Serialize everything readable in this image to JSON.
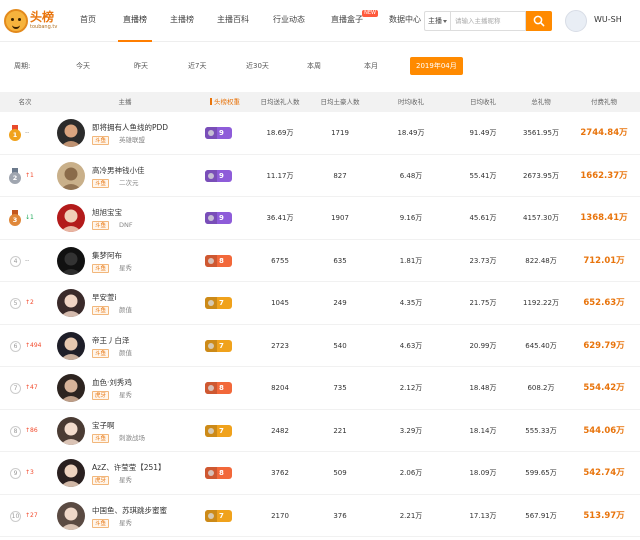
{
  "header": {
    "logo_text": "头榜",
    "logo_sub": "toubang.tv",
    "nav": [
      {
        "label": "首页",
        "active": false,
        "badge": ""
      },
      {
        "label": "直播榜",
        "active": true,
        "badge": ""
      },
      {
        "label": "主播榜",
        "active": false,
        "badge": ""
      },
      {
        "label": "主播百科",
        "active": false,
        "badge": ""
      },
      {
        "label": "行业动态",
        "active": false,
        "badge": ""
      },
      {
        "label": "直播盒子",
        "active": false,
        "badge": "NEW"
      },
      {
        "label": "数据中心",
        "active": false,
        "badge": ""
      }
    ],
    "search": {
      "type_label": "主播",
      "placeholder": "请输入主播昵称",
      "value": ""
    },
    "username": "WU-SH"
  },
  "period": {
    "label": "周期:",
    "options": [
      "今天",
      "昨天",
      "近7天",
      "近30天",
      "本周",
      "本月",
      "2019年04月"
    ],
    "selected": "2019年04月"
  },
  "table": {
    "columns": [
      "名次",
      "主播",
      "头榜权重",
      "日均送礼人数",
      "日均土豪人数",
      "时均收礼",
      "日均收礼",
      "总礼物",
      "付费礼物"
    ],
    "sorted_column": "付费礼物",
    "rows": [
      {
        "rank": "1",
        "trend": "--",
        "trend_dir": "flat",
        "name": "即将拥有人鱼线的PDD",
        "platform": "斗鱼",
        "category": "英雄联盟",
        "weight": "9",
        "weight_color": "#8e5cd9",
        "givers": "18.69万",
        "big_spenders": "1719",
        "hourly": "18.49万",
        "daily": "91.49万",
        "total": "3561.95万",
        "paid": "2744.84万"
      },
      {
        "rank": "2",
        "trend": "1",
        "trend_dir": "up",
        "name": "高冷男神钱小佳",
        "platform": "斗鱼",
        "category": "二次元",
        "weight": "9",
        "weight_color": "#8e5cd9",
        "givers": "11.17万",
        "big_spenders": "827",
        "hourly": "6.48万",
        "daily": "55.41万",
        "total": "2673.95万",
        "paid": "1662.37万"
      },
      {
        "rank": "3",
        "trend": "1",
        "trend_dir": "down",
        "name": "旭旭宝宝",
        "platform": "斗鱼",
        "category": "DNF",
        "weight": "9",
        "weight_color": "#8e5cd9",
        "givers": "36.41万",
        "big_spenders": "1907",
        "hourly": "9.16万",
        "daily": "45.61万",
        "total": "4157.30万",
        "paid": "1368.41万"
      },
      {
        "rank": "4",
        "trend": "--",
        "trend_dir": "flat",
        "name": "集梦阿布",
        "platform": "斗鱼",
        "category": "星秀",
        "weight": "8",
        "weight_color": "#f2683a",
        "givers": "6755",
        "big_spenders": "635",
        "hourly": "1.81万",
        "daily": "23.73万",
        "total": "822.48万",
        "paid": "712.01万"
      },
      {
        "rank": "5",
        "trend": "2",
        "trend_dir": "up",
        "name": "早安萱i",
        "platform": "斗鱼",
        "category": "颜值",
        "weight": "7",
        "weight_color": "#f0a21c",
        "givers": "1045",
        "big_spenders": "249",
        "hourly": "4.35万",
        "daily": "21.75万",
        "total": "1192.22万",
        "paid": "652.63万"
      },
      {
        "rank": "6",
        "trend": "494",
        "trend_dir": "up",
        "name": "帝王丿白泽",
        "platform": "斗鱼",
        "category": "颜值",
        "weight": "7",
        "weight_color": "#f0a21c",
        "givers": "2723",
        "big_spenders": "540",
        "hourly": "4.63万",
        "daily": "20.99万",
        "total": "645.40万",
        "paid": "629.79万"
      },
      {
        "rank": "7",
        "trend": "47",
        "trend_dir": "up",
        "name": "血色·刘秀鸡",
        "platform": "虎牙",
        "category": "星秀",
        "weight": "8",
        "weight_color": "#f2683a",
        "givers": "8204",
        "big_spenders": "735",
        "hourly": "2.12万",
        "daily": "18.48万",
        "total": "608.2万",
        "paid": "554.42万"
      },
      {
        "rank": "8",
        "trend": "86",
        "trend_dir": "up",
        "name": "宝子啊",
        "platform": "斗鱼",
        "category": "刺激战场",
        "weight": "7",
        "weight_color": "#f0a21c",
        "givers": "2482",
        "big_spenders": "221",
        "hourly": "3.29万",
        "daily": "18.14万",
        "total": "555.33万",
        "paid": "544.06万"
      },
      {
        "rank": "9",
        "trend": "3",
        "trend_dir": "up",
        "name": "AzZ、许莹莹【251】",
        "platform": "虎牙",
        "category": "星秀",
        "weight": "8",
        "weight_color": "#f2683a",
        "givers": "3762",
        "big_spenders": "509",
        "hourly": "2.06万",
        "daily": "18.09万",
        "total": "599.65万",
        "paid": "542.74万"
      },
      {
        "rank": "10",
        "trend": "27",
        "trend_dir": "up",
        "name": "中国鱼、苏琪跳步蜜蜜",
        "platform": "斗鱼",
        "category": "星秀",
        "weight": "7",
        "weight_color": "#f0a21c",
        "givers": "2170",
        "big_spenders": "376",
        "hourly": "2.21万",
        "daily": "17.13万",
        "total": "567.91万",
        "paid": "513.97万"
      }
    ]
  }
}
